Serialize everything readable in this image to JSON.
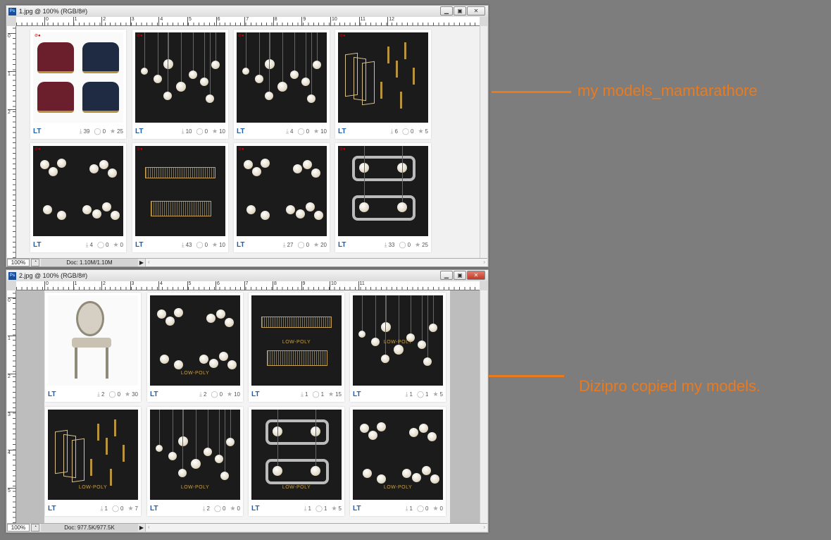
{
  "windows": [
    {
      "title": "1.jpg @ 100% (RGB/8#)",
      "zoom": "100%",
      "doc": "Doc: 1.10M/1.10M",
      "ruler_h": [
        "0",
        "1",
        "2",
        "3",
        "4",
        "5",
        "6",
        "7",
        "8",
        "9",
        "10",
        "11",
        "12"
      ],
      "ruler_v": [
        "0",
        "1",
        "2"
      ],
      "cards": [
        {
          "brand": "LT",
          "downloads": "39",
          "comments": "0",
          "stars": "25",
          "image": "armchairs",
          "low_poly": ""
        },
        {
          "brand": "LT",
          "downloads": "10",
          "comments": "0",
          "stars": "10",
          "image": "pendants",
          "low_poly": ""
        },
        {
          "brand": "LT",
          "downloads": "4",
          "comments": "0",
          "stars": "10",
          "image": "pendants",
          "low_poly": ""
        },
        {
          "brand": "LT",
          "downloads": "6",
          "comments": "0",
          "stars": "5",
          "image": "hex-pendants",
          "low_poly": ""
        },
        {
          "brand": "LT",
          "downloads": "4",
          "comments": "0",
          "stars": "0",
          "image": "globe-chandeliers",
          "low_poly": ""
        },
        {
          "brand": "LT",
          "downloads": "43",
          "comments": "0",
          "stars": "10",
          "image": "crystal-chandelier",
          "low_poly": ""
        },
        {
          "brand": "LT",
          "downloads": "27",
          "comments": "0",
          "stars": "20",
          "image": "globe-chandeliers",
          "low_poly": ""
        },
        {
          "brand": "LT",
          "downloads": "33",
          "comments": "0",
          "stars": "25",
          "image": "ring-chandelier",
          "low_poly": ""
        }
      ]
    },
    {
      "title": "2.jpg @ 100% (RGB/8#)",
      "zoom": "100%",
      "doc": "Doc: 977.5K/977.5K",
      "ruler_h": [
        "0",
        "1",
        "2",
        "3",
        "4",
        "5",
        "6",
        "7",
        "8",
        "9",
        "10",
        "11"
      ],
      "ruler_v": [
        "0",
        "1",
        "2",
        "3",
        "4",
        "5"
      ],
      "cards": [
        {
          "brand": "LT",
          "downloads": "2",
          "comments": "0",
          "stars": "30",
          "image": "chair",
          "low_poly": ""
        },
        {
          "brand": "LT",
          "downloads": "2",
          "comments": "0",
          "stars": "10",
          "image": "globe-chandeliers",
          "low_poly": "LOW-POLY"
        },
        {
          "brand": "LT",
          "downloads": "1",
          "comments": "1",
          "stars": "15",
          "image": "crystal-chandelier",
          "low_poly": "LOW-POLY"
        },
        {
          "brand": "LT",
          "downloads": "1",
          "comments": "1",
          "stars": "5",
          "image": "pendants",
          "low_poly": "LOW-POLY"
        },
        {
          "brand": "LT",
          "downloads": "1",
          "comments": "0",
          "stars": "7",
          "image": "hex-pendants",
          "low_poly": "LOW-POLY"
        },
        {
          "brand": "LT",
          "downloads": "2",
          "comments": "0",
          "stars": "0",
          "image": "pendants",
          "low_poly": "LOW-POLY"
        },
        {
          "brand": "LT",
          "downloads": "1",
          "comments": "1",
          "stars": "5",
          "image": "ring-chandelier",
          "low_poly": "LOW-POLY"
        },
        {
          "brand": "LT",
          "downloads": "1",
          "comments": "0",
          "stars": "0",
          "image": "globe-chandeliers",
          "low_poly": "LOW-POLY"
        }
      ]
    }
  ],
  "annotations": {
    "first": "my models_mamtarathore",
    "second": "Dizipro copied my models."
  },
  "colors": {
    "accent": "#ea7a1e",
    "brand": "#1e5fa8"
  }
}
